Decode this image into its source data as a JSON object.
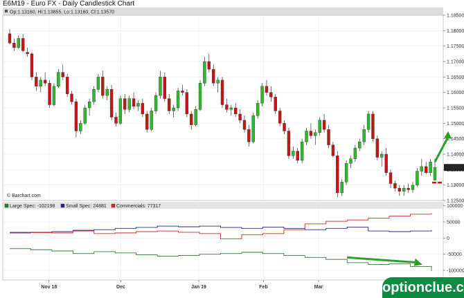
{
  "header": {
    "title": "E6M19 - Euro FX - Daily Candlestick Chart",
    "ohlc": "Op:1.13160, Hi:1.13855, Lo:1.13160, Cl:1.13570"
  },
  "source": "© Barchart.com",
  "watermark": "optionclue.com",
  "last_price_label": "1.13570",
  "colors": {
    "up": "#2eb82e",
    "down": "#c81414",
    "large_spec": "#2e7d32",
    "small_spec": "#23238a",
    "commercials": "#d62728",
    "arrow": "#2aa02a",
    "brand": "#0f8a43"
  },
  "chart_data": [
    {
      "type": "candlestick",
      "title": "E6M19 - Euro FX - Daily Candlestick Chart",
      "ylim": [
        1.125,
        1.185
      ],
      "yticks": [
        "1.12500",
        "1.13000",
        "1.13500",
        "1.14000",
        "1.14500",
        "1.15000",
        "1.15500",
        "1.16000",
        "1.16500",
        "1.17000",
        "1.17500",
        "1.18000",
        "1.18500"
      ],
      "x_labels": [
        "Nov 18",
        "Dec",
        "Jan 19",
        "Feb",
        "Mar"
      ],
      "candles": [
        [
          1.179,
          1.1805,
          1.1755,
          1.176
        ],
        [
          1.176,
          1.1775,
          1.1735,
          1.1745
        ],
        [
          1.1745,
          1.1785,
          1.174,
          1.1775
        ],
        [
          1.1775,
          1.179,
          1.173,
          1.1735
        ],
        [
          1.173,
          1.1745,
          1.1715,
          1.1725
        ],
        [
          1.1725,
          1.173,
          1.164,
          1.165
        ],
        [
          1.165,
          1.1665,
          1.1605,
          1.162
        ],
        [
          1.162,
          1.165,
          1.16,
          1.164
        ],
        [
          1.164,
          1.1665,
          1.162,
          1.163
        ],
        [
          1.163,
          1.164,
          1.155,
          1.156
        ],
        [
          1.156,
          1.163,
          1.1555,
          1.162
        ],
        [
          1.162,
          1.1675,
          1.1615,
          1.1665
        ],
        [
          1.1665,
          1.169,
          1.164,
          1.165
        ],
        [
          1.165,
          1.166,
          1.1585,
          1.1595
        ],
        [
          1.1595,
          1.1605,
          1.156,
          1.157
        ],
        [
          1.157,
          1.158,
          1.1455,
          1.1475
        ],
        [
          1.1475,
          1.151,
          1.1465,
          1.15
        ],
        [
          1.15,
          1.156,
          1.1495,
          1.155
        ],
        [
          1.155,
          1.158,
          1.1525,
          1.157
        ],
        [
          1.157,
          1.162,
          1.156,
          1.161
        ],
        [
          1.161,
          1.166,
          1.16,
          1.165
        ],
        [
          1.165,
          1.167,
          1.158,
          1.159
        ],
        [
          1.159,
          1.162,
          1.1575,
          1.161
        ],
        [
          1.161,
          1.1625,
          1.151,
          1.152
        ],
        [
          1.152,
          1.1535,
          1.149,
          1.15
        ],
        [
          1.15,
          1.159,
          1.1495,
          1.158
        ],
        [
          1.158,
          1.1595,
          1.153,
          1.1545
        ],
        [
          1.1545,
          1.159,
          1.1535,
          1.158
        ],
        [
          1.158,
          1.16,
          1.1545,
          1.1555
        ],
        [
          1.1555,
          1.1575,
          1.154,
          1.1565
        ],
        [
          1.1565,
          1.158,
          1.152,
          1.153
        ],
        [
          1.153,
          1.154,
          1.147,
          1.148
        ],
        [
          1.148,
          1.155,
          1.1475,
          1.154
        ],
        [
          1.154,
          1.16,
          1.153,
          1.159
        ],
        [
          1.159,
          1.167,
          1.158,
          1.165
        ],
        [
          1.165,
          1.1665,
          1.157,
          1.158
        ],
        [
          1.158,
          1.1595,
          1.153,
          1.154
        ],
        [
          1.154,
          1.156,
          1.152,
          1.155
        ],
        [
          1.155,
          1.1615,
          1.154,
          1.1605
        ],
        [
          1.1605,
          1.1625,
          1.159,
          1.16
        ],
        [
          1.16,
          1.161,
          1.152,
          1.153
        ],
        [
          1.153,
          1.154,
          1.148,
          1.1495
        ],
        [
          1.1495,
          1.1555,
          1.149,
          1.1545
        ],
        [
          1.1545,
          1.164,
          1.154,
          1.163
        ],
        [
          1.163,
          1.1715,
          1.162,
          1.17
        ],
        [
          1.17,
          1.1725,
          1.1665,
          1.1675
        ],
        [
          1.1675,
          1.169,
          1.162,
          1.163
        ],
        [
          1.163,
          1.165,
          1.16,
          1.164
        ],
        [
          1.164,
          1.165,
          1.155,
          1.156
        ],
        [
          1.156,
          1.158,
          1.1535,
          1.1545
        ],
        [
          1.1545,
          1.156,
          1.1525,
          1.155
        ],
        [
          1.155,
          1.1565,
          1.152,
          1.153
        ],
        [
          1.153,
          1.1545,
          1.15,
          1.151
        ],
        [
          1.151,
          1.1525,
          1.147,
          1.148
        ],
        [
          1.148,
          1.1495,
          1.1425,
          1.144
        ],
        [
          1.144,
          1.1535,
          1.1435,
          1.1525
        ],
        [
          1.1525,
          1.1575,
          1.1515,
          1.1565
        ],
        [
          1.1565,
          1.163,
          1.1555,
          1.162
        ],
        [
          1.162,
          1.164,
          1.159,
          1.16
        ],
        [
          1.16,
          1.162,
          1.157,
          1.1585
        ],
        [
          1.1585,
          1.1595,
          1.153,
          1.154
        ],
        [
          1.154,
          1.155,
          1.149,
          1.15
        ],
        [
          1.15,
          1.151,
          1.1465,
          1.1475
        ],
        [
          1.1475,
          1.1485,
          1.1385,
          1.1395
        ],
        [
          1.1395,
          1.1425,
          1.1385,
          1.141
        ],
        [
          1.141,
          1.142,
          1.137,
          1.138
        ],
        [
          1.138,
          1.145,
          1.137,
          1.144
        ],
        [
          1.144,
          1.1485,
          1.143,
          1.1475
        ],
        [
          1.1475,
          1.15,
          1.145,
          1.146
        ],
        [
          1.146,
          1.148,
          1.143,
          1.147
        ],
        [
          1.147,
          1.152,
          1.146,
          1.151
        ],
        [
          1.151,
          1.153,
          1.147,
          1.148
        ],
        [
          1.148,
          1.1495,
          1.142,
          1.143
        ],
        [
          1.143,
          1.144,
          1.139,
          1.1395
        ],
        [
          1.1395,
          1.141,
          1.126,
          1.1275
        ],
        [
          1.1275,
          1.132,
          1.1265,
          1.131
        ],
        [
          1.131,
          1.138,
          1.13,
          1.137
        ],
        [
          1.137,
          1.1395,
          1.1355,
          1.1385
        ],
        [
          1.1385,
          1.143,
          1.1375,
          1.142
        ],
        [
          1.142,
          1.145,
          1.141,
          1.144
        ],
        [
          1.144,
          1.1495,
          1.143,
          1.148
        ],
        [
          1.148,
          1.154,
          1.147,
          1.153
        ],
        [
          1.153,
          1.154,
          1.144,
          1.145
        ],
        [
          1.145,
          1.146,
          1.138,
          1.139
        ],
        [
          1.139,
          1.141,
          1.136,
          1.14
        ],
        [
          1.14,
          1.142,
          1.133,
          1.134
        ],
        [
          1.134,
          1.135,
          1.129,
          1.1305
        ],
        [
          1.1305,
          1.1315,
          1.128,
          1.129
        ],
        [
          1.129,
          1.13,
          1.1265,
          1.128
        ],
        [
          1.128,
          1.13,
          1.1265,
          1.129
        ],
        [
          1.129,
          1.1305,
          1.1275,
          1.1285
        ],
        [
          1.1285,
          1.131,
          1.1275,
          1.13
        ],
        [
          1.13,
          1.1355,
          1.1295,
          1.1345
        ],
        [
          1.1345,
          1.1385,
          1.133,
          1.136
        ],
        [
          1.136,
          1.1375,
          1.1335,
          1.134
        ],
        [
          1.134,
          1.1385,
          1.133,
          1.1375
        ],
        [
          1.1316,
          1.13855,
          1.1316,
          1.1357
        ]
      ],
      "annotations": {
        "arrow": {
          "from_index": 96,
          "from_value": 1.1375,
          "to_index": 99,
          "to_value": 1.147
        },
        "dash_level": 1.1308
      }
    },
    {
      "type": "line",
      "ylim": [
        -130000,
        110000
      ],
      "yticks": [
        100000,
        50000,
        0,
        -50000,
        -100000
      ],
      "ytick_labels": [
        "100000",
        "50000",
        "0",
        "-50000",
        "-100000"
      ],
      "series": [
        {
          "name": "Large Spec",
          "legend": "Large Spec: -102198",
          "values": [
            -33000,
            -33000,
            -36000,
            -36000,
            -40000,
            -40000,
            -48000,
            -48000,
            -42000,
            -42000,
            -46000,
            -46000,
            -52000,
            -52000,
            -56000,
            -56000,
            -54000,
            -54000,
            -50000,
            -50000,
            -48000,
            -48000,
            -44000,
            -44000,
            -48000,
            -48000,
            -54000,
            -54000,
            -60000,
            -60000,
            -66000,
            -66000,
            -76000,
            -76000,
            -82000,
            -82000,
            -80000,
            -80000,
            -88000,
            -88000,
            -102198
          ]
        },
        {
          "name": "Small Spec",
          "legend": "Small Spec: 24881",
          "values": [
            16000,
            16000,
            18000,
            18000,
            20000,
            20000,
            24000,
            24000,
            26000,
            26000,
            30000,
            30000,
            33000,
            33000,
            37000,
            37000,
            35000,
            35000,
            37000,
            37000,
            33000,
            33000,
            30000,
            30000,
            34000,
            34000,
            30000,
            30000,
            26000,
            26000,
            30000,
            30000,
            34000,
            34000,
            22000,
            22000,
            20000,
            20000,
            22000,
            22000,
            24881
          ]
        },
        {
          "name": "Commercials",
          "legend": "Commercials: 77317",
          "values": [
            18000,
            18000,
            17000,
            17000,
            16000,
            16000,
            22000,
            22000,
            14000,
            14000,
            16000,
            16000,
            20000,
            20000,
            22000,
            22000,
            18000,
            18000,
            14000,
            14000,
            -2000,
            -2000,
            10000,
            10000,
            14000,
            14000,
            26000,
            26000,
            44000,
            44000,
            52000,
            52000,
            56000,
            56000,
            62000,
            62000,
            68000,
            68000,
            74000,
            74000,
            77317
          ]
        }
      ],
      "annotations": {
        "arrow": {
          "from_index": 32,
          "from_value": -60000,
          "to_index": 39,
          "to_value": -80000
        }
      }
    }
  ]
}
